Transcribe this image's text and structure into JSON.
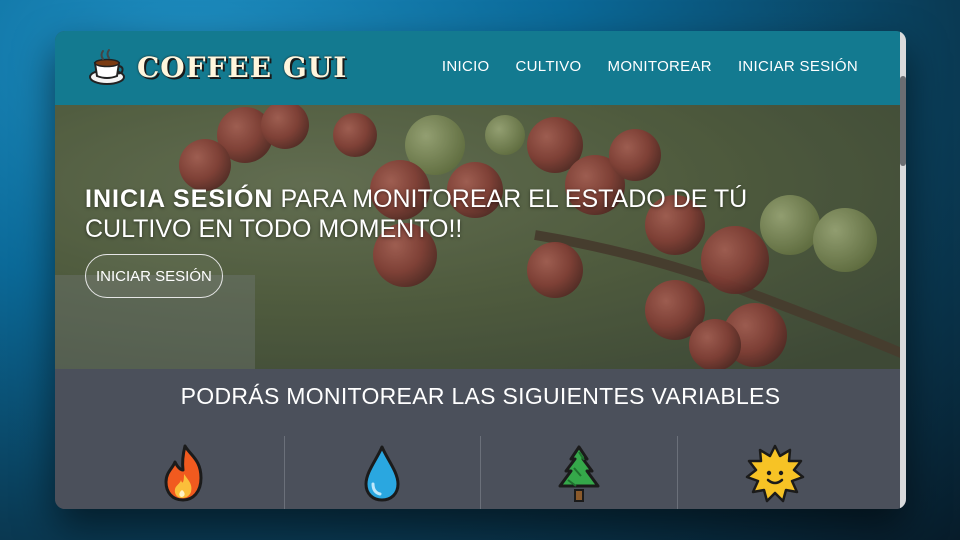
{
  "brand": {
    "title": "COFFEE GUI",
    "logo_icon": "coffee-cup-icon"
  },
  "nav": {
    "items": [
      "INICIO",
      "CULTIVO",
      "MONITOREAR",
      "INICIAR SESIÓN"
    ]
  },
  "hero": {
    "headline_strong": "INICIA SESIÓN",
    "headline_rest": " PARA MONITOREAR EL ESTADO DE TÚ CULTIVO EN TODO MOMENTO!!",
    "button_label": "INICIAR SESIÓN"
  },
  "variables": {
    "title": "PODRÁS MONITOREAR LAS SIGUIENTES VARIABLES",
    "icons": [
      "fire-icon",
      "water-drop-icon",
      "tree-icon",
      "sun-icon"
    ]
  },
  "colors": {
    "navbar": "#137a90",
    "section_bg": "#4b505b",
    "accent_text": "#ffffff"
  }
}
